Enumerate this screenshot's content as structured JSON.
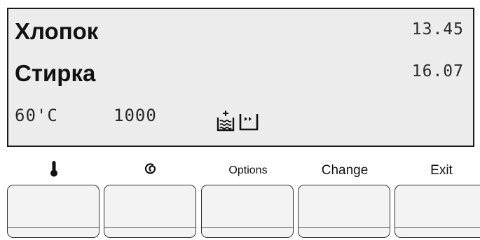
{
  "display": {
    "program": "Хлопок",
    "phase": "Стирка",
    "time1": "13.45",
    "time2": "16.07",
    "temperature": "60'C",
    "spin": "1000",
    "status_icons": [
      "prewash-icon",
      "quick-wash-icon"
    ]
  },
  "buttons": [
    {
      "label": "",
      "icon": "thermometer-icon"
    },
    {
      "label": "",
      "icon": "spin-icon"
    },
    {
      "label": "Options"
    },
    {
      "label": "Change"
    },
    {
      "label": "Exit"
    }
  ],
  "colors": {
    "display_bg": "#ececec",
    "border": "#1a1a1a",
    "key_bg": "#f3f3f3"
  }
}
